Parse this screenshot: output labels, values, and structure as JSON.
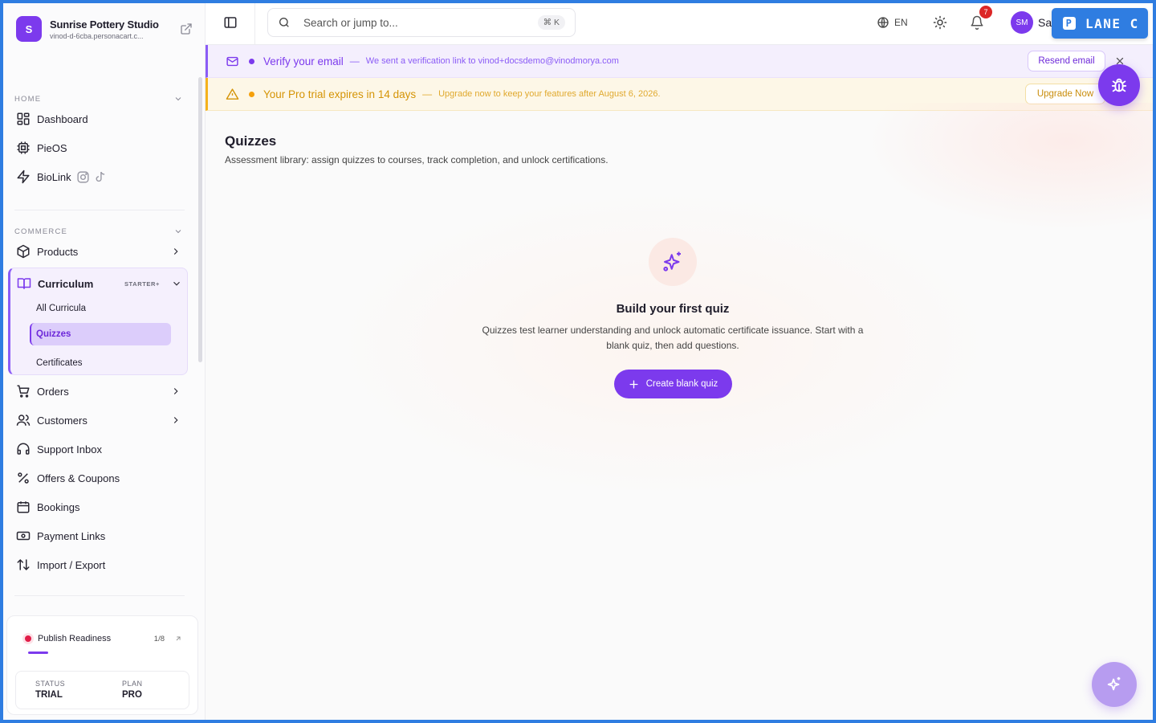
{
  "brand": {
    "initial": "S",
    "name": "Sunrise Pottery Studio",
    "url": "vinod-d-6cba.personacart.c..."
  },
  "sidebar": {
    "sections": {
      "home": "HOME",
      "commerce": "COMMERCE"
    },
    "home_items": [
      {
        "label": "Dashboard",
        "icon": "dashboard-icon"
      },
      {
        "label": "PieOS",
        "icon": "chip-icon"
      },
      {
        "label": "BioLink",
        "icon": "lightning-icon"
      }
    ],
    "commerce_items": [
      {
        "label": "Products",
        "icon": "box-icon"
      },
      {
        "label": "Orders",
        "icon": "cart-icon"
      },
      {
        "label": "Customers",
        "icon": "users-icon"
      },
      {
        "label": "Support Inbox",
        "icon": "headset-icon"
      },
      {
        "label": "Offers & Coupons",
        "icon": "percent-icon"
      },
      {
        "label": "Bookings",
        "icon": "calendar-icon"
      },
      {
        "label": "Payment Links",
        "icon": "money-icon"
      },
      {
        "label": "Import / Export",
        "icon": "arrows-icon"
      }
    ],
    "curriculum": {
      "label": "Curriculum",
      "badge": "STARTER+",
      "subitems": [
        "All Curricula",
        "Quizzes",
        "Certificates"
      ],
      "active": "Quizzes"
    },
    "readiness": {
      "label": "Publish Readiness",
      "count": "1/8",
      "progress": 0.125
    },
    "status": {
      "label": "STATUS",
      "value": "TRIAL"
    },
    "plan": {
      "label": "PLAN",
      "value": "PRO"
    }
  },
  "topbar": {
    "search_placeholder": "Search or jump to...",
    "shortcut": "⌘ K",
    "language": "EN",
    "notifications": "7",
    "avatar_initials": "SM",
    "user_name": "Sa",
    "lane": "LANE C"
  },
  "banners": {
    "verify": {
      "title": "Verify your email",
      "dash": "—",
      "message": "We sent a verification link to vinod+docsdemo@vinodmorya.com",
      "button": "Resend email"
    },
    "trial": {
      "title": "Your Pro trial expires in 14 days",
      "dash": "—",
      "message": "Upgrade now to keep your features after August 6, 2026.",
      "button": "Upgrade Now"
    }
  },
  "page": {
    "title": "Quizzes",
    "subtitle": "Assessment library: assign quizzes to courses, track completion, and unlock certifications.",
    "empty_title": "Build your first quiz",
    "empty_desc": "Quizzes test learner understanding and unlock automatic certificate issuance. Start with a blank quiz, then add questions.",
    "create_button": "Create blank quiz"
  },
  "colors": {
    "accent": "#7c3aed",
    "frame": "#2f7de1",
    "warning": "#f5b21b",
    "danger": "#dc2626"
  }
}
